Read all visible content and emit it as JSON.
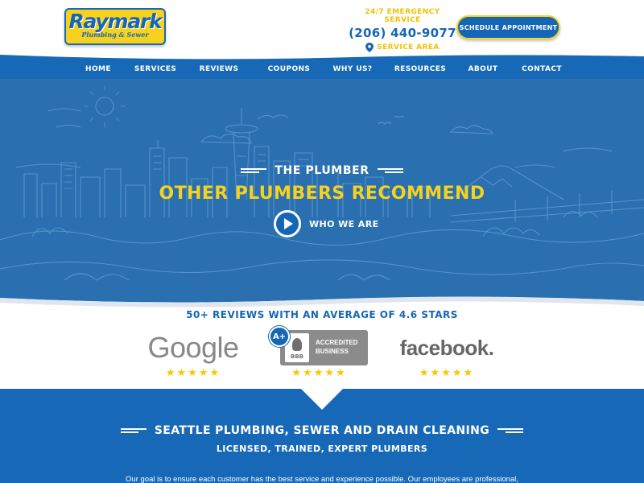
{
  "header": {
    "logo_name": "Raymark",
    "logo_tagline": "Plumbing & Sewer",
    "emergency_label": "24/7 EMERGENCY SERVICE",
    "phone": "(206) 440-9077",
    "service_area_label": "SERVICE AREA",
    "schedule_button": "SCHEDULE APPOINTMENT"
  },
  "nav": {
    "items": [
      "HOME",
      "SERVICES",
      "REVIEWS",
      "COUPONS",
      "WHY US?",
      "RESOURCES",
      "ABOUT",
      "CONTACT"
    ]
  },
  "hero": {
    "kicker": "THE PLUMBER",
    "headline": "OTHER PLUMBERS RECOMMEND",
    "video_label": "WHO WE ARE"
  },
  "reviews": {
    "heading": "50+ REVIEWS WITH AN AVERAGE OF 4.6 STARS",
    "google_logo": "Google",
    "bbb_rating": "A+",
    "bbb_line1": "ACCREDITED",
    "bbb_line2": "BUSINESS",
    "bbb_mark": "BBB",
    "facebook_logo": "facebook.",
    "stars": "★★★★★",
    "star_count": 5
  },
  "section": {
    "title": "SEATTLE PLUMBING, SEWER AND DRAIN CLEANING",
    "subtitle": "LICENSED, TRAINED, EXPERT PLUMBERS",
    "intro": "Our goal is to ensure each customer has the best service and experience possible. Our employees are professional,"
  },
  "colors": {
    "brand_blue": "#1769b8",
    "brand_yellow": "#f6d11e",
    "hero_blue": "#2a6fb0"
  },
  "icons": [
    "location-pin-icon",
    "play-icon",
    "star-icon",
    "bbb-torch-icon"
  ]
}
